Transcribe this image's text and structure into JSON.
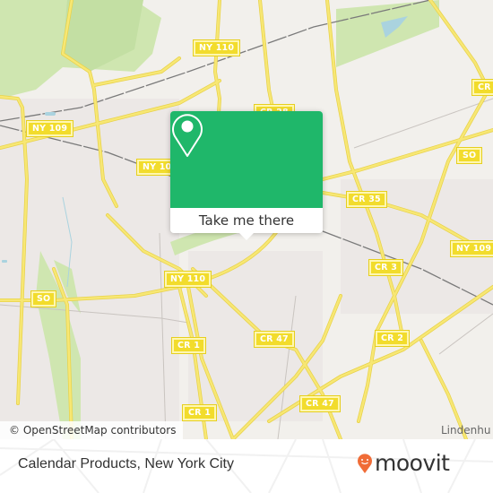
{
  "map": {
    "labels": {
      "ny109_west": "NY 109",
      "ny10x_west": "NY 10",
      "ny110_north": "NY 110",
      "cr28": "CR 28",
      "cr_east": "CR",
      "so_east": "SO",
      "cr35": "CR 35",
      "ny109_east": "NY 109",
      "cr3": "CR 3",
      "cr2": "CR 2",
      "so_west": "SO",
      "ny110_south": "NY 110",
      "cr1_north": "CR 1",
      "cr47_mid": "CR 47",
      "cr47_south": "CR 47",
      "cr1_south": "CR 1"
    },
    "place_label": "Lindenhu",
    "attribution": "© OpenStreetMap contributors",
    "colors": {
      "land": "#f2f0ec",
      "road": "#f6e565",
      "park": "#cfe6b0",
      "water": "#aad3df",
      "popup_green": "#1fb76a"
    }
  },
  "popup": {
    "icon": "map-pin-icon",
    "button_label": "Take me there"
  },
  "footer": {
    "place_name": "Calendar Products, New York City",
    "brand": "moovit",
    "brand_color": "#f06c37"
  }
}
